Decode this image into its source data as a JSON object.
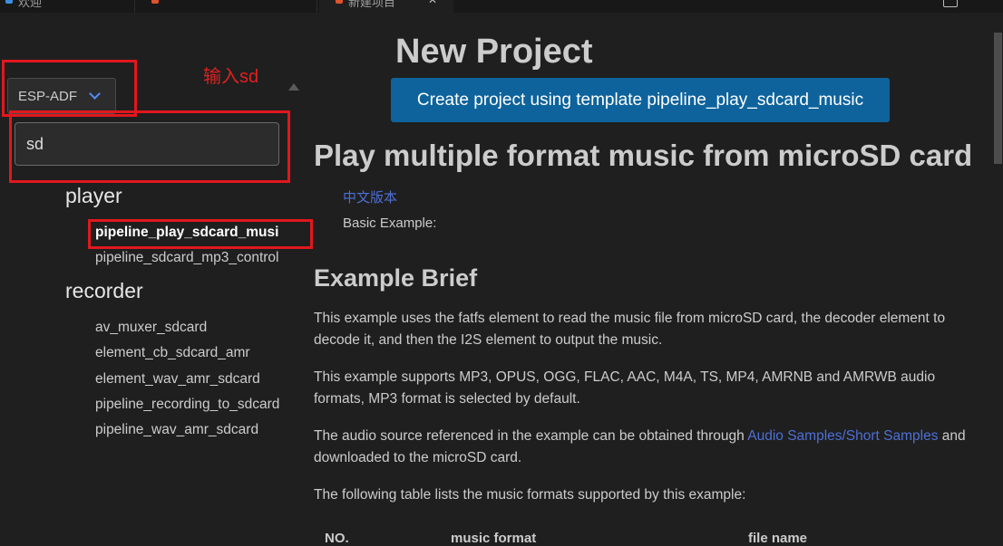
{
  "tabs": [
    {
      "label": "欢迎"
    },
    {
      "label": ""
    },
    {
      "label": "新建项目"
    }
  ],
  "sidebar": {
    "framework_select": {
      "value": "ESP-ADF"
    },
    "annotation": "输入sd",
    "search": {
      "value": "sd"
    },
    "groups": [
      {
        "title": "player",
        "items": [
          "pipeline_play_sdcard_musi",
          "pipeline_sdcard_mp3_control"
        ]
      },
      {
        "title": "recorder",
        "items": [
          "av_muxer_sdcard",
          "element_cb_sdcard_amr",
          "element_wav_amr_sdcard",
          "pipeline_recording_to_sdcard",
          "pipeline_wav_amr_sdcard"
        ]
      }
    ]
  },
  "main": {
    "title": "New Project",
    "create_button": "Create project using template pipeline_play_sdcard_music",
    "readme": {
      "title": "Play multiple format music from microSD card",
      "lang_link": "中文版本",
      "basic_example": "Basic Example:",
      "brief_title": "Example Brief",
      "p1": "This example uses the fatfs element to read the music file from microSD card, the decoder element to decode it, and then the I2S element to output the music.",
      "p2": "This example supports MP3, OPUS, OGG, FLAC, AAC, M4A, TS, MP4, AMRNB and AMRWB audio formats, MP3 format is selected by default.",
      "p3_before": "The audio source referenced in the example can be obtained through ",
      "p3_link": "Audio Samples/Short Samples",
      "p3_after": " and downloaded to the microSD card.",
      "p4": "The following table lists the music formats supported by this example:",
      "table_headers": [
        "NO.",
        "music format",
        "file name"
      ]
    }
  },
  "colors": {
    "background": "#1f1f1f",
    "button": "#0e639c",
    "link": "#4d6fd6",
    "annotation": "#e1171e"
  }
}
